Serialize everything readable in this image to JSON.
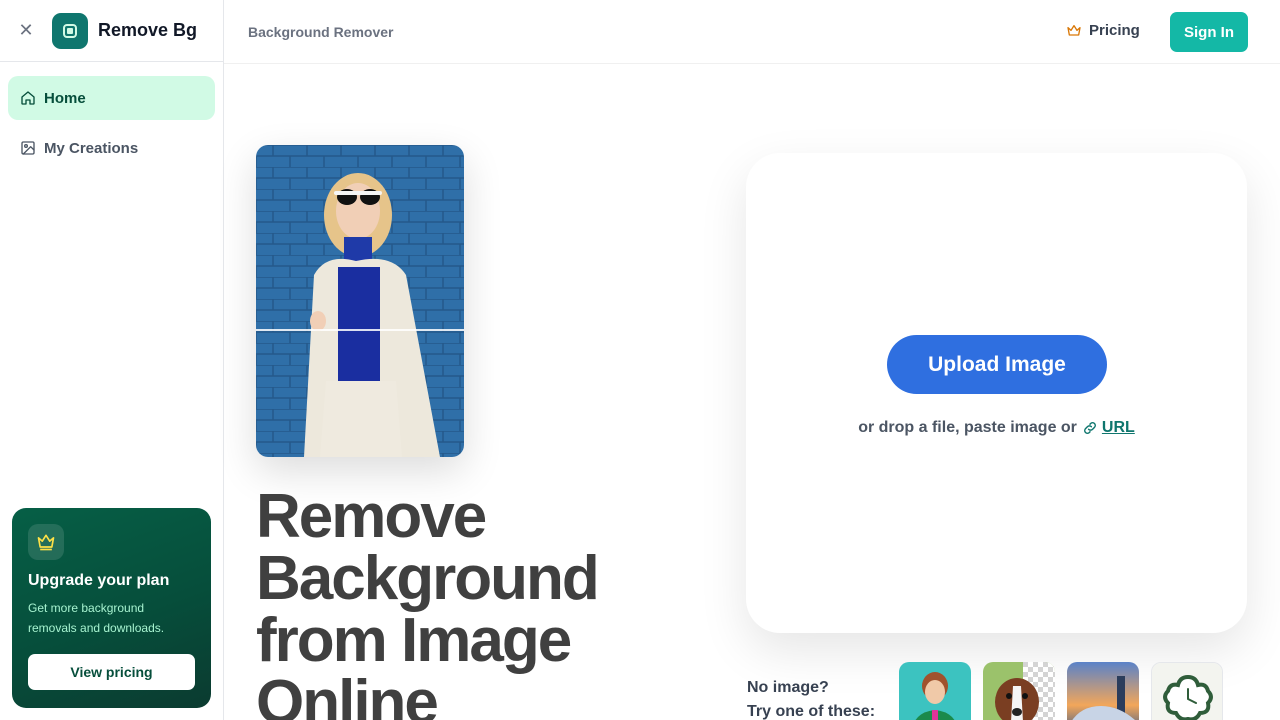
{
  "sidebar": {
    "brand": "Remove Bg",
    "nav": [
      {
        "label": "Home",
        "icon": "home-icon",
        "active": true
      },
      {
        "label": "My Creations",
        "icon": "gallery-icon",
        "active": false
      }
    ],
    "upgrade": {
      "title": "Upgrade your plan",
      "description": "Get more background removals and downloads.",
      "button": "View pricing",
      "icon": "crown-icon"
    }
  },
  "header": {
    "breadcrumb": "Background Remover",
    "pricing": "Pricing",
    "sign_in": "Sign In"
  },
  "hero": {
    "headline": "Remove Background from Image Online"
  },
  "upload": {
    "button": "Upload Image",
    "drop_text": "or drop a file, paste image or",
    "url_label": "URL"
  },
  "samples": {
    "line1": "No image?",
    "line2": "Try one of these:"
  },
  "colors": {
    "accent": "#14b8a6",
    "upload_blue": "#2f6fe0",
    "brand_green": "#0f766e"
  }
}
